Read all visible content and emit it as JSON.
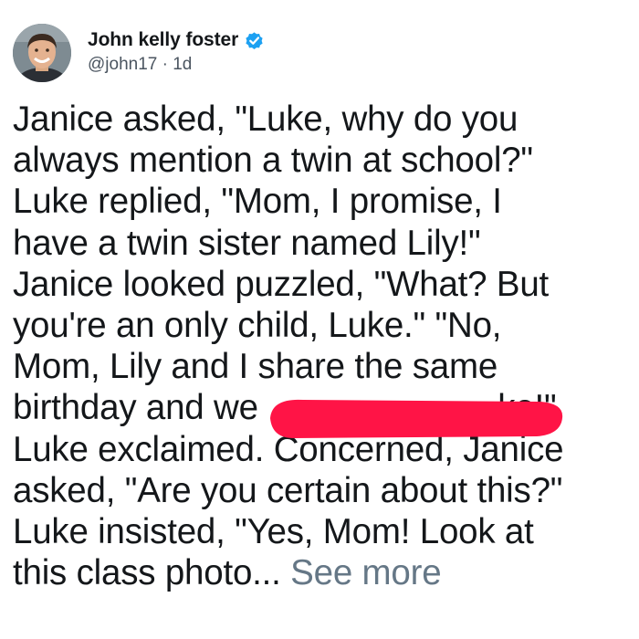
{
  "tweet": {
    "author": {
      "display_name": "John kelly foster",
      "handle": "@john17",
      "verified_icon": "verified-badge-icon",
      "avatar": "avatar-photo"
    },
    "timestamp": "1d",
    "separator": "·",
    "text": "Janice asked, \"Luke, why do you\nalways mention a twin at school?\"\nLuke replied, \"Mom, I promise, I\nhave a twin sister named Lily!\"\nJanice looked puzzled, \"What? But\nyou're an only child, Luke.\" \"No,\nMom, Lily and I share the same\nbirthday and we                         ke!\"\nLuke exclaimed. Concerned, Janice\nasked, \"Are you certain about this?\"\nLuke insisted, \"Yes, Mom! Look at\nthis class photo... ",
    "see_more_label": "See more",
    "redaction_color": "#ff1446"
  },
  "colors": {
    "text": "#14171a",
    "secondary_text": "#657786",
    "verified": "#1da1f2"
  }
}
